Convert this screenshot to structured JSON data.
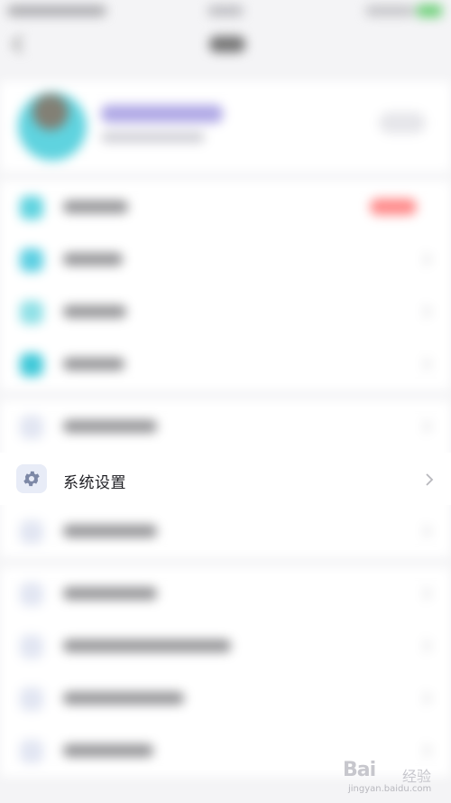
{
  "settings_item": {
    "label": "系统设置",
    "icon": "gear-icon",
    "chevron_icon": "chevron-right-icon",
    "icon_bg_color": "#e8ecf7",
    "icon_color": "#7d88a6"
  },
  "watermark": {
    "brand": "Bai",
    "brand_cn": "经验",
    "url": "jingyan.baidu.com"
  },
  "colors": {
    "background": "#f4f4f6",
    "card": "#ffffff",
    "text_primary": "#1f1f24",
    "chevron": "#b8b8bd"
  }
}
